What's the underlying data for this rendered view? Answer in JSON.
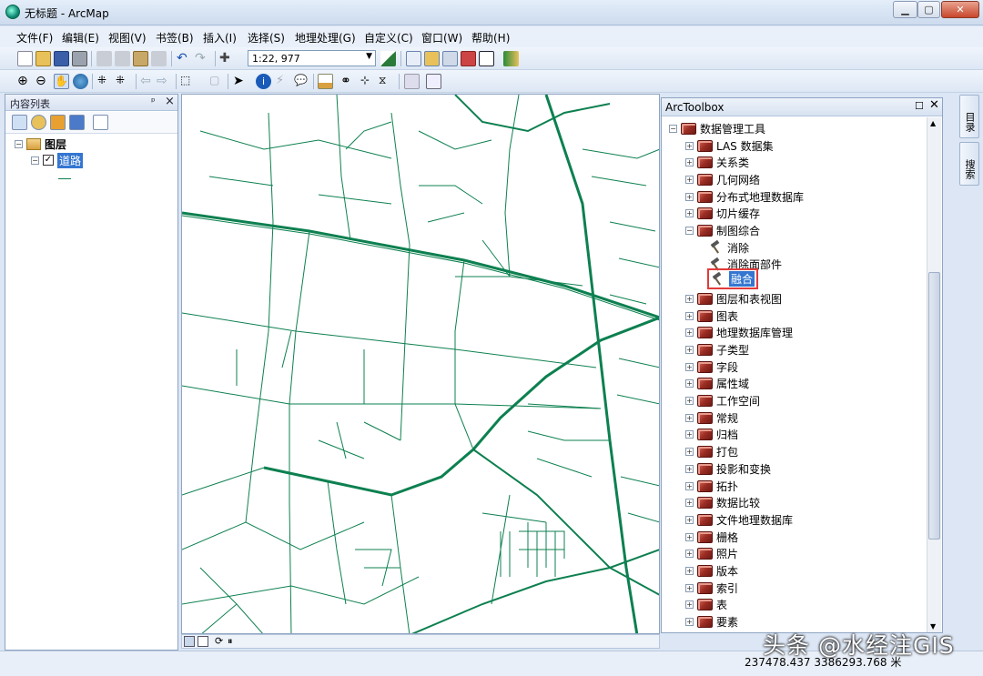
{
  "window": {
    "title": "无标题 - ArcMap"
  },
  "menu": [
    "文件(F)",
    "编辑(E)",
    "视图(V)",
    "书签(B)",
    "插入(I)",
    "选择(S)",
    "地理处理(G)",
    "自定义(C)",
    "窗口(W)",
    "帮助(H)"
  ],
  "toolbar": {
    "scale_value": "1:22, 977"
  },
  "toc": {
    "title": "内容列表",
    "pin": "ᵖ",
    "close": "×",
    "group_label": "图层",
    "layer_label": "道路"
  },
  "arctoolbox": {
    "title": "ArcToolbox",
    "root": "数据管理工具",
    "items": [
      {
        "label": "LAS 数据集",
        "kind": "toolbox"
      },
      {
        "label": "关系类",
        "kind": "toolbox"
      },
      {
        "label": "几何网络",
        "kind": "toolbox"
      },
      {
        "label": "分布式地理数据库",
        "kind": "toolbox"
      },
      {
        "label": "切片缓存",
        "kind": "toolbox"
      },
      {
        "label": "制图综合",
        "kind": "toolbox-open"
      },
      {
        "label": "消除",
        "kind": "tool"
      },
      {
        "label": "消除面部件",
        "kind": "tool"
      },
      {
        "label": "融合",
        "kind": "tool-selected"
      },
      {
        "label": "图层和表视图",
        "kind": "toolbox"
      },
      {
        "label": "图表",
        "kind": "toolbox"
      },
      {
        "label": "地理数据库管理",
        "kind": "toolbox"
      },
      {
        "label": "子类型",
        "kind": "toolbox"
      },
      {
        "label": "字段",
        "kind": "toolbox"
      },
      {
        "label": "属性域",
        "kind": "toolbox"
      },
      {
        "label": "工作空间",
        "kind": "toolbox"
      },
      {
        "label": "常规",
        "kind": "toolbox"
      },
      {
        "label": "归档",
        "kind": "toolbox"
      },
      {
        "label": "打包",
        "kind": "toolbox"
      },
      {
        "label": "投影和变换",
        "kind": "toolbox"
      },
      {
        "label": "拓扑",
        "kind": "toolbox"
      },
      {
        "label": "数据比较",
        "kind": "toolbox"
      },
      {
        "label": "文件地理数据库",
        "kind": "toolbox"
      },
      {
        "label": "栅格",
        "kind": "toolbox"
      },
      {
        "label": "照片",
        "kind": "toolbox"
      },
      {
        "label": "版本",
        "kind": "toolbox"
      },
      {
        "label": "索引",
        "kind": "toolbox"
      },
      {
        "label": "表",
        "kind": "toolbox"
      },
      {
        "label": "要素",
        "kind": "toolbox"
      }
    ]
  },
  "right_tabs": [
    "目录",
    "搜索"
  ],
  "status": {
    "coordinates": "237478.437  3386293.768 米"
  },
  "watermark": "头条 @水经注GIS",
  "colors": {
    "road": "#0d8050",
    "selection": "#3476d1",
    "highlight_box": "#e23b3b"
  }
}
